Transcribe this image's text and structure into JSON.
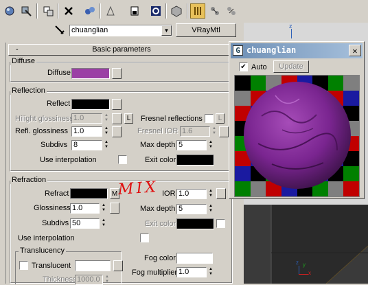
{
  "material": {
    "name": "chuanglian",
    "type_button": "VRayMtl"
  },
  "rollout": {
    "collapse": "-",
    "title": "Basic parameters"
  },
  "diffuse": {
    "group": "Diffuse",
    "label": "Diffuse",
    "color": "#9b3fa5"
  },
  "reflection": {
    "group": "Reflection",
    "reflect": "Reflect",
    "hilight_glossiness": "Hilight glossiness",
    "hilight_value": "1.0",
    "lock": "L",
    "fresnel": "Fresnel reflections",
    "fresnel_lock": "L",
    "refl_glossiness": "Refl. glossiness",
    "refl_value": "1.0",
    "fresnel_ior": "Fresnel IOR",
    "fresnel_ior_value": "1.6",
    "subdivs": "Subdivs",
    "subdivs_value": "8",
    "max_depth": "Max depth",
    "max_depth_value": "5",
    "use_interpolation": "Use interpolation",
    "exit_color": "Exit color",
    "reflect_color": "#000000",
    "exit_color_value": "#000000"
  },
  "refraction": {
    "group": "Refraction",
    "refract": "Refract",
    "m_button": "M",
    "ior": "IOR",
    "ior_value": "1.0",
    "glossiness": "Glossiness",
    "glossiness_value": "1.0",
    "max_depth": "Max depth",
    "max_depth_value": "5",
    "subdivs": "Subdivs",
    "subdivs_value": "50",
    "exit_color": "Exit color",
    "use_interpolation": "Use interpolation",
    "refract_color": "#000000",
    "exit_color_value": "#000000"
  },
  "translucency": {
    "group": "Translucency",
    "translucent": "Translucent",
    "thickness": "Thickness",
    "thickness_value": "1000.0",
    "fog_color": "Fog color",
    "fog_multiplier": "Fog multiplier",
    "fog_multiplier_value": "1.0",
    "translucent_color": "#ffffff",
    "fog_color_value": "#ffffff"
  },
  "annotation": "MIX",
  "preview": {
    "title": "chuanglian",
    "close": "✕",
    "auto": "Auto",
    "auto_checked": "✔",
    "update": "Update"
  },
  "viewport": {
    "axis_z_top": "z",
    "axis_z_bottom": "z",
    "axis_x": "x",
    "axis_y": "y"
  },
  "icons": {
    "toolbar": [
      "get-material-icon",
      "put-to-scene-icon",
      "assign-icon",
      "delete-icon",
      "make-unique-icon",
      "put-to-library-icon",
      "material-effects-icon",
      "show-map-icon",
      "show-end-result-icon",
      "go-to-parent-icon",
      "go-forward-icon",
      "eyedropper-icon"
    ]
  },
  "colors": {
    "accent_active": "#e8c15a",
    "sphere": "#8a2c98"
  }
}
